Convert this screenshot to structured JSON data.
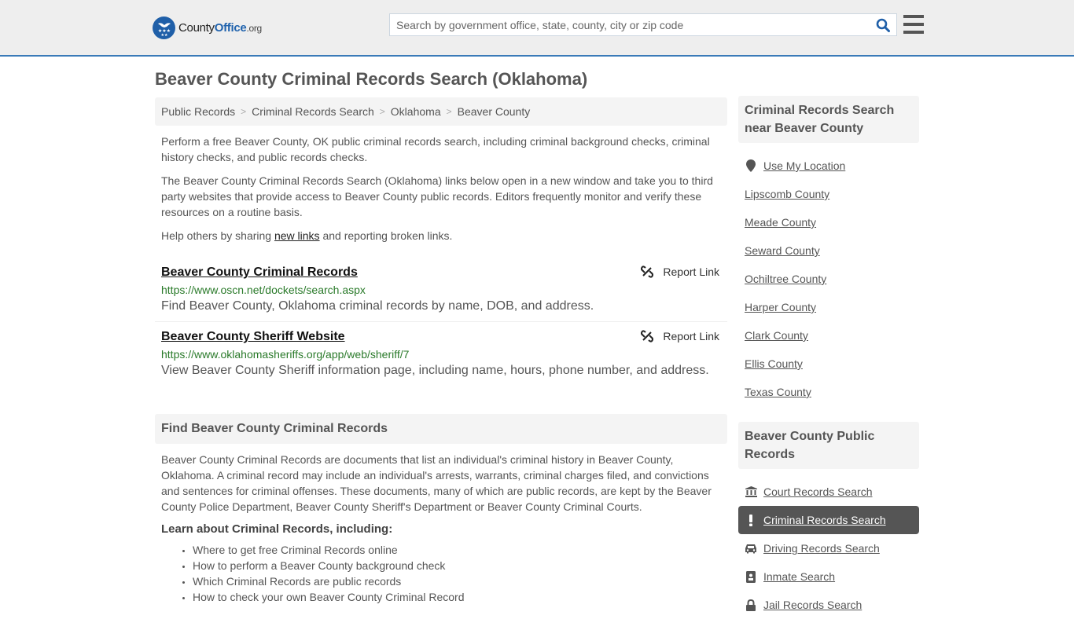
{
  "header": {
    "logo": {
      "prefix": "County",
      "brand": "Office",
      "tld": ".org"
    },
    "search": {
      "placeholder": "Search by government office, state, county, city or zip code",
      "value": ""
    },
    "icons": {
      "search": "search-icon",
      "menu": "hamburger-menu-icon"
    }
  },
  "page": {
    "title": "Beaver County Criminal Records Search (Oklahoma)"
  },
  "breadcrumb": [
    {
      "label": "Public Records"
    },
    {
      "label": "Criminal Records Search"
    },
    {
      "label": "Oklahoma"
    },
    {
      "label": "Beaver County"
    }
  ],
  "breadcrumb_separator": ">",
  "intro": {
    "p1": "Perform a free Beaver County, OK public criminal records search, including criminal background checks, criminal history checks, and public records checks.",
    "p2": "The Beaver County Criminal Records Search (Oklahoma) links below open in a new window and take you to third party websites that provide access to Beaver County public records. Editors frequently monitor and verify these resources on a routine basis.",
    "p3_before": "Help others by sharing ",
    "p3_link": "new links",
    "p3_after": " and reporting broken links."
  },
  "links": [
    {
      "title": "Beaver County Criminal Records",
      "url": "https://www.oscn.net/dockets/search.aspx",
      "description": "Find Beaver County, Oklahoma criminal records by name, DOB, and address.",
      "report_label": "Report Link"
    },
    {
      "title": "Beaver County Sheriff Website",
      "url": "https://www.oklahomasheriffs.org/app/web/sheriff/7",
      "description": "View Beaver County Sheriff information page, including name, hours, phone number, and address.",
      "report_label": "Report Link"
    }
  ],
  "find_section": {
    "heading": "Find Beaver County Criminal Records",
    "body": "Beaver County Criminal Records are documents that list an individual's criminal history in Beaver County, Oklahoma. A criminal record may include an individual's arrests, warrants, criminal charges filed, and convictions and sentences for criminal offenses. These documents, many of which are public records, are kept by the Beaver County Police Department, Beaver County Sheriff's Department or Beaver County Criminal Courts.",
    "learn_heading": "Learn about Criminal Records, including:",
    "learn_items": [
      "Where to get free Criminal Records online",
      "How to perform a Beaver County background check",
      "Which Criminal Records are public records",
      "How to check your own Beaver County Criminal Record"
    ]
  },
  "sidebar": {
    "nearby_heading": "Criminal Records Search near Beaver County",
    "use_location": {
      "label": "Use My Location",
      "icon": "map-marker-icon"
    },
    "nearby": [
      "Lipscomb County",
      "Meade County",
      "Seward County",
      "Ochiltree County",
      "Harper County",
      "Clark County",
      "Ellis County",
      "Texas County"
    ],
    "public_heading": "Beaver County Public Records",
    "public_records": [
      {
        "label": "Court Records Search",
        "icon": "courthouse-icon",
        "active": false
      },
      {
        "label": "Criminal Records Search",
        "icon": "exclamation-icon",
        "active": true
      },
      {
        "label": "Driving Records Search",
        "icon": "car-icon",
        "active": false
      },
      {
        "label": "Inmate Search",
        "icon": "id-badge-icon",
        "active": false
      },
      {
        "label": "Jail Records Search",
        "icon": "lock-icon",
        "active": false
      }
    ]
  },
  "colors": {
    "brand_blue": "#1f62ad",
    "header_border": "#3a7ab8",
    "url_green": "#2a7a2a",
    "active_item_bg": "#555555",
    "panel_bg": "#f4f4f4"
  }
}
